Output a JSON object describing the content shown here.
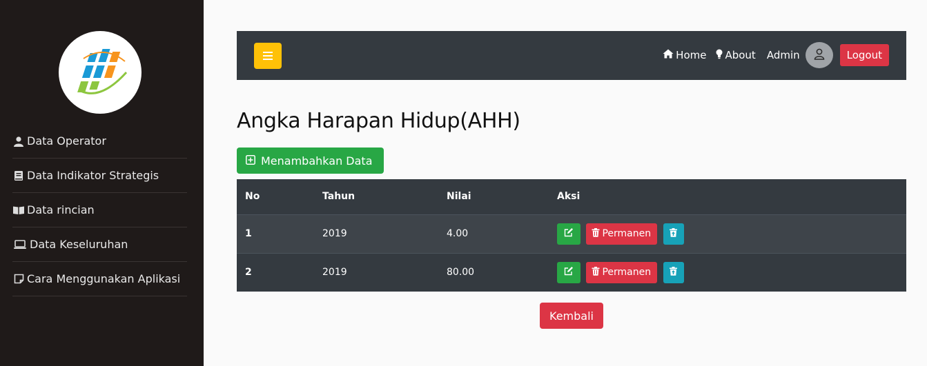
{
  "sidebar": {
    "logo": "bps-logo",
    "items": [
      {
        "label": "Data Operator",
        "icon": "user-icon"
      },
      {
        "label": "Data Indikator Strategis",
        "icon": "book-icon"
      },
      {
        "label": "Data rincian",
        "icon": "open-book-icon"
      },
      {
        "label": "Data Keseluruhan",
        "icon": "laptop-icon"
      },
      {
        "label": "Cara Menggunakan Aplikasi",
        "icon": "note-icon"
      }
    ]
  },
  "topbar": {
    "menu_icon": "hamburger-icon",
    "home_label": "Home",
    "about_label": "About",
    "user_name": "Admin",
    "logout_label": "Logout"
  },
  "main": {
    "title": "Angka Harapan Hidup(AHH)",
    "add_label": "Menambahkan Data",
    "table": {
      "headers": [
        "No",
        "Tahun",
        "Nilai",
        "Aksi"
      ],
      "rows": [
        {
          "no": "1",
          "tahun": "2019",
          "nilai": "4.00"
        },
        {
          "no": "2",
          "tahun": "2019",
          "nilai": "80.00"
        }
      ],
      "delete_label": "Permanen"
    },
    "back_label": "Kembali"
  },
  "colors": {
    "sidebar_bg": "#1f1a19",
    "topbar_bg": "#343a40",
    "warning": "#ffc107",
    "success": "#28a745",
    "danger": "#dc3545",
    "info": "#17a2b8"
  }
}
